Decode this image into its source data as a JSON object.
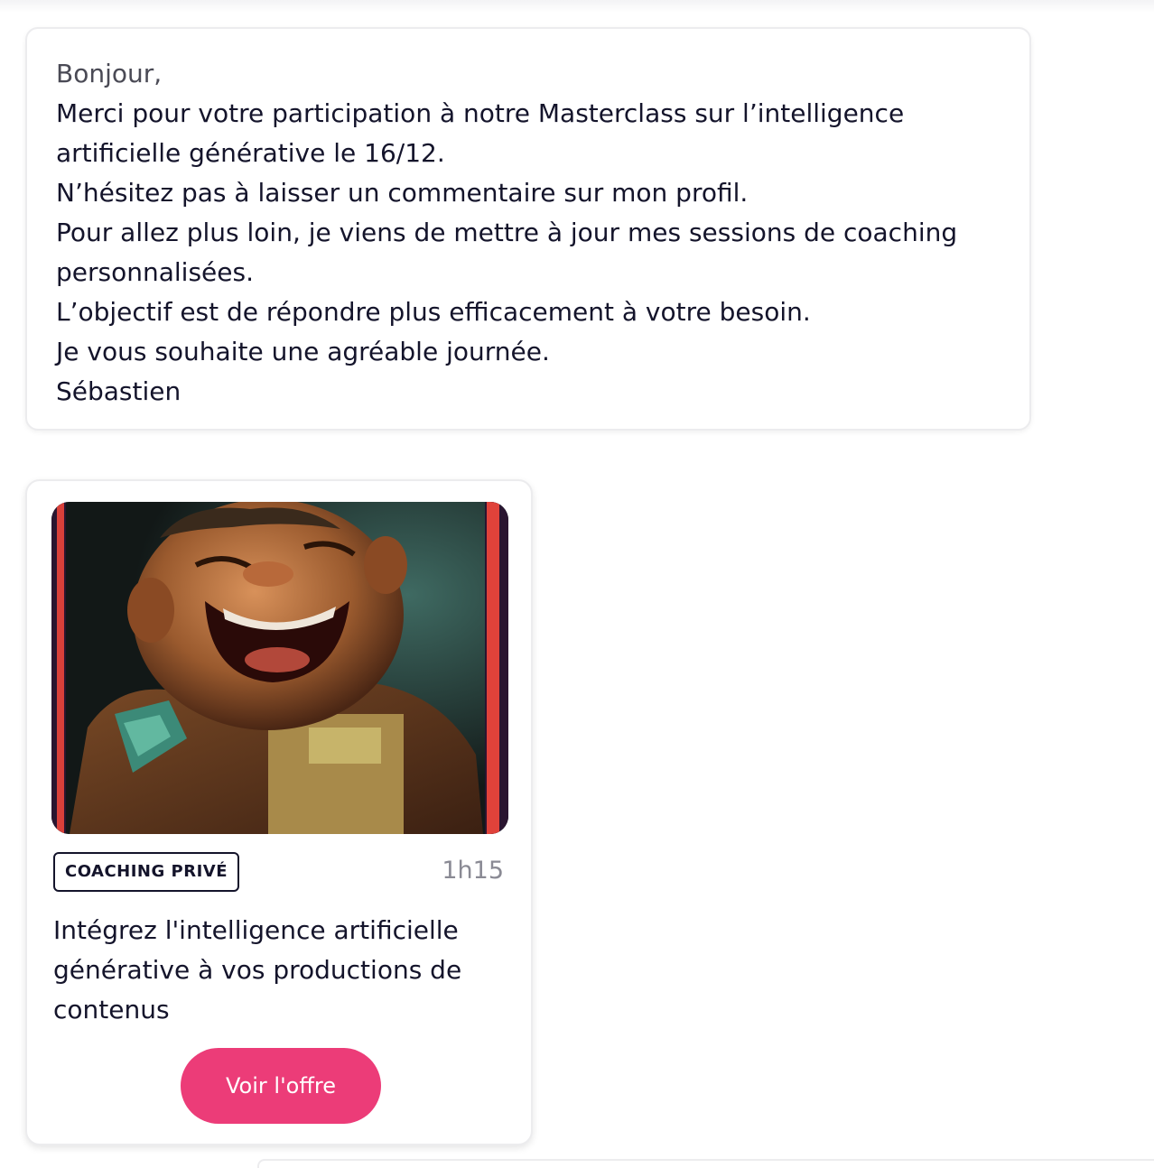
{
  "message": {
    "lines": [
      "Bonjour,",
      "Merci pour votre participation à notre Masterclass sur l’intelligence",
      "artificielle générative le 16/12.",
      "N’hésitez pas à laisser un commentaire sur mon profil.",
      "Pour allez plus loin, je viens de mettre à jour mes sessions de coaching",
      "personnalisées.",
      "L’objectif est de répondre plus efficacement à votre besoin.",
      "Je vous souhaite une agréable journée.",
      "Sébastien"
    ]
  },
  "offer": {
    "tag": "COACHING PRIVÉ",
    "duration": "1h15",
    "title_lines": [
      "Intégrez l'intelligence artificielle",
      "générative à vos productions de",
      "contenus"
    ],
    "button_label": "Voir l'offre"
  },
  "colors": {
    "accent": "#ec3c78",
    "text": "#14142b",
    "muted": "#8a8a94",
    "border": "#ececee"
  }
}
